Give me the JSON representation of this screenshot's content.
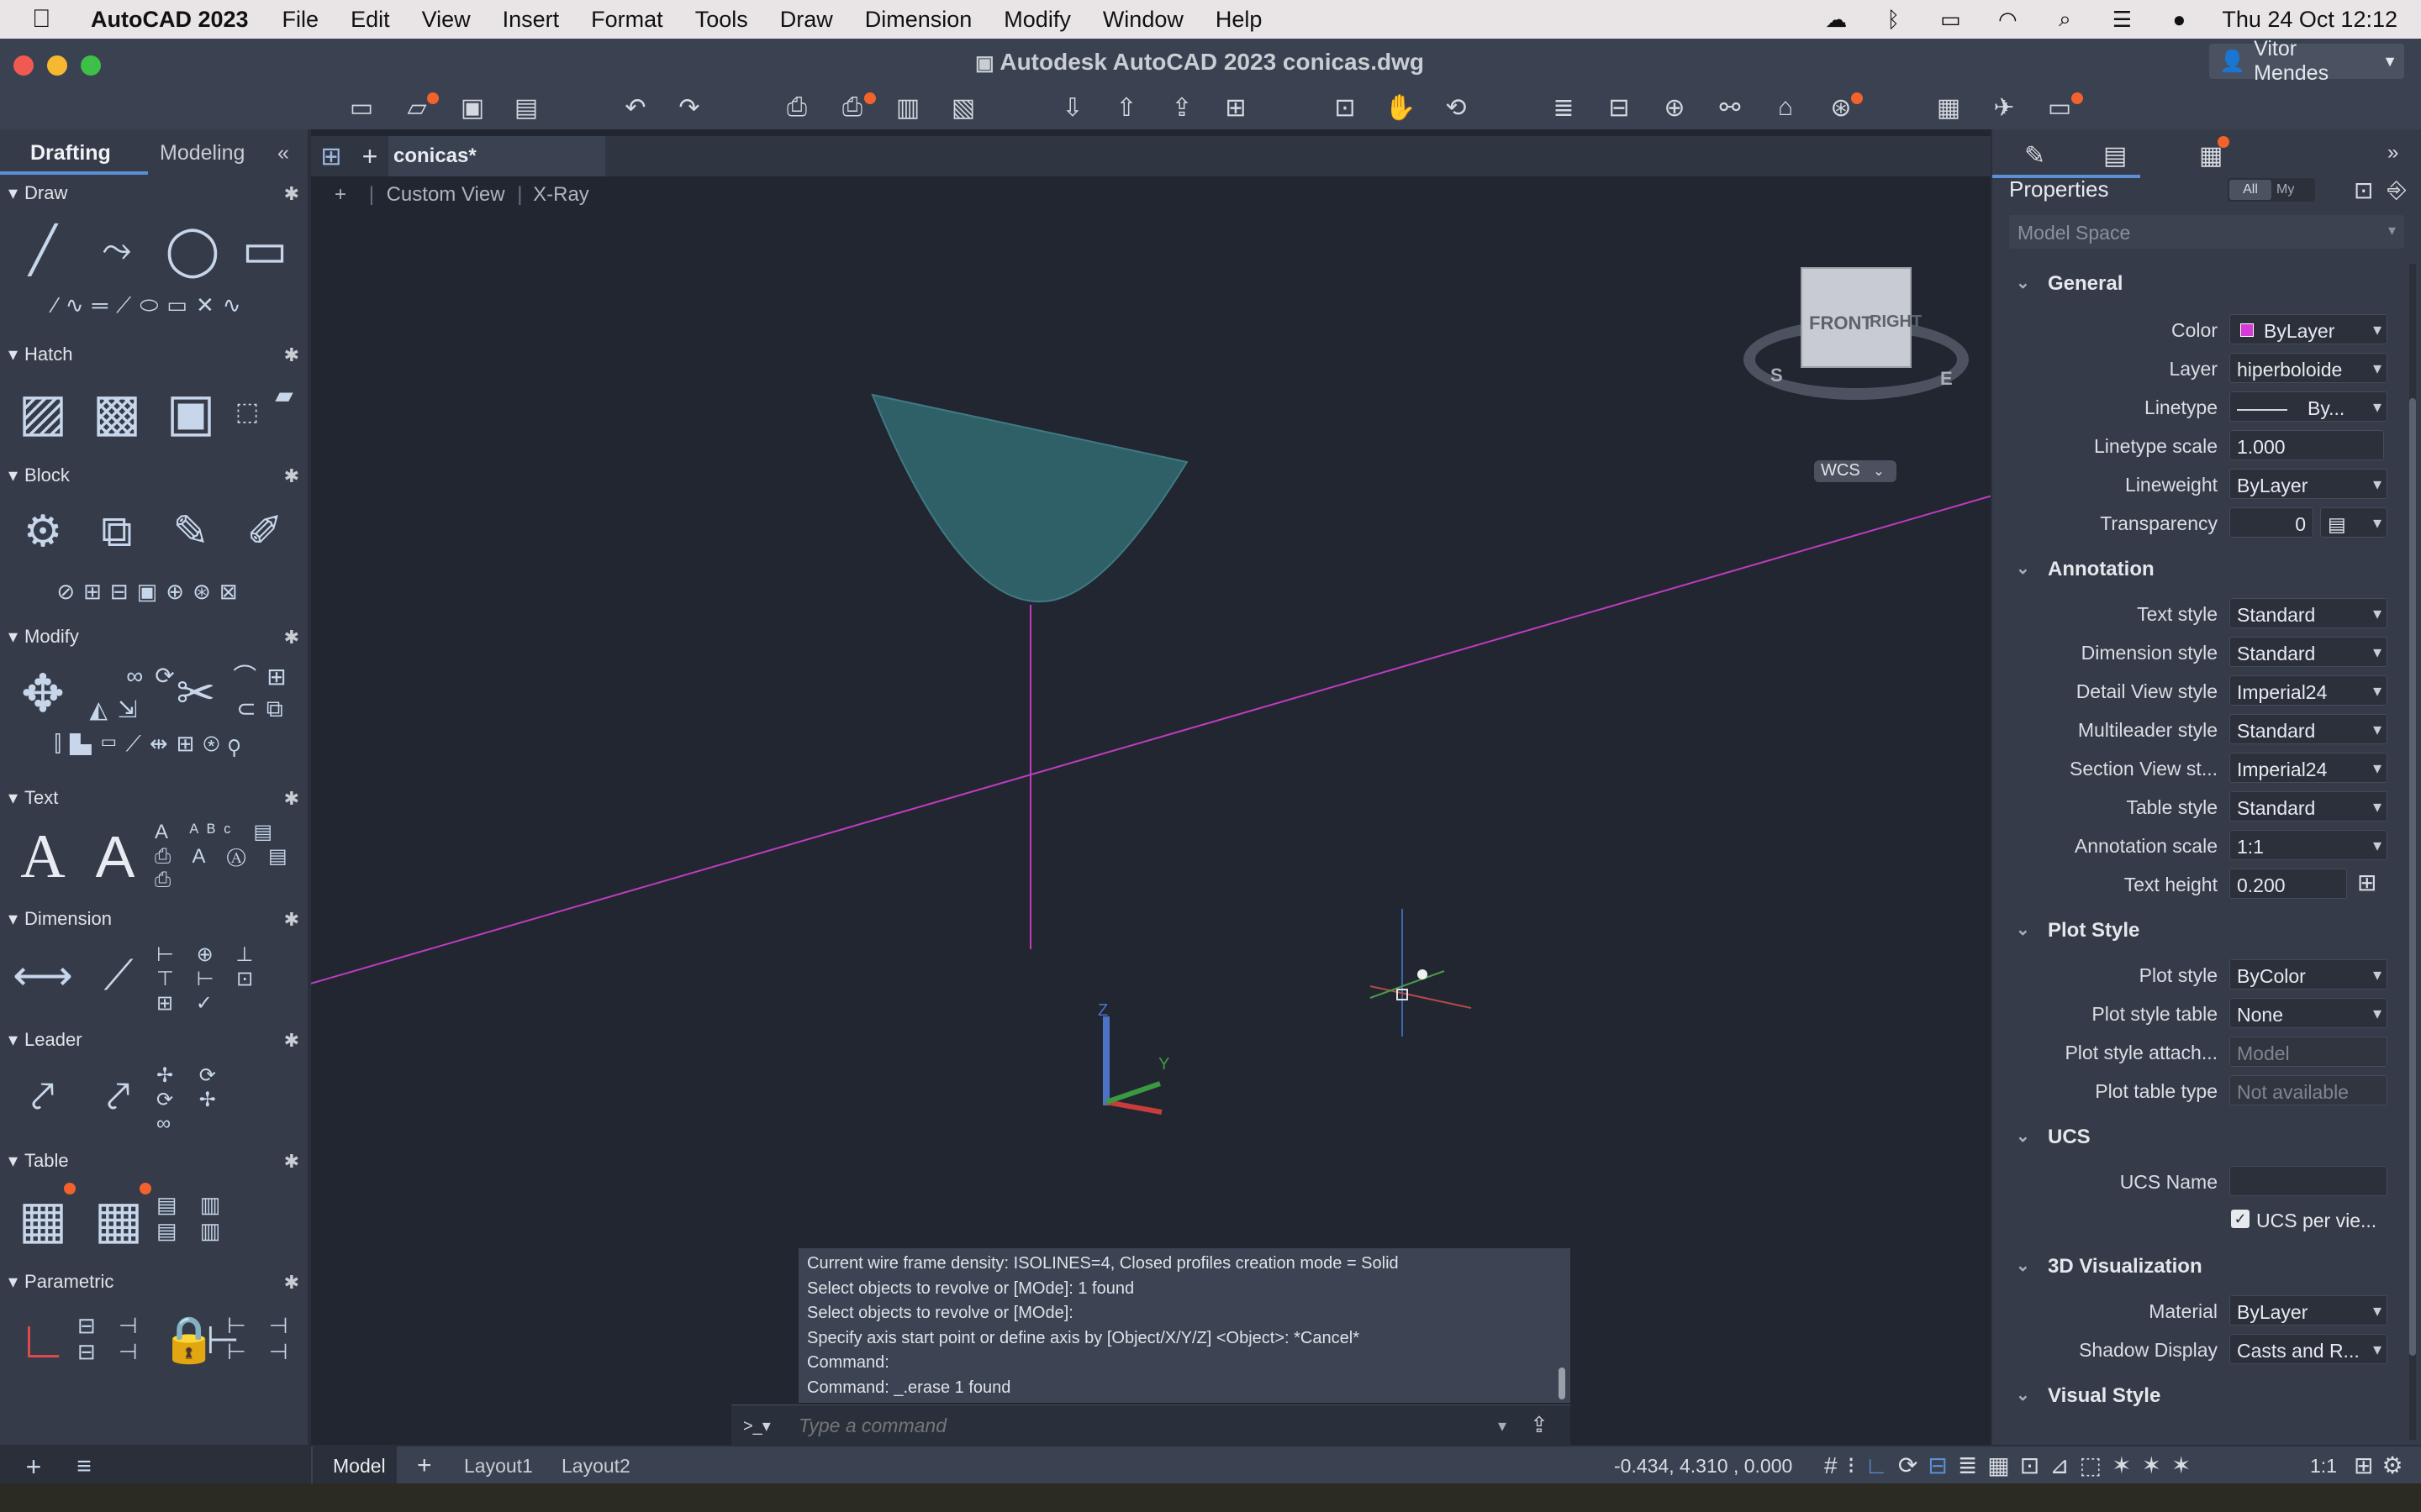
{
  "menubar": {
    "app_name": "AutoCAD 2023",
    "items": [
      "File",
      "Edit",
      "View",
      "Insert",
      "Format",
      "Tools",
      "Draw",
      "Dimension",
      "Modify",
      "Window",
      "Help"
    ],
    "clock": "Thu 24 Oct  12:12"
  },
  "titlebar": {
    "title": "Autodesk AutoCAD 2023    conicas.dwg",
    "user": "Vitor Mendes"
  },
  "left_panel": {
    "tabs": [
      "Drafting",
      "Modeling"
    ],
    "sections": [
      "Draw",
      "Hatch",
      "Block",
      "Modify",
      "Text",
      "Dimension",
      "Leader",
      "Table",
      "Parametric"
    ]
  },
  "doc_tab": "conicas*",
  "viewport": {
    "custom_view": "Custom View",
    "visual_style": "X-Ray",
    "viewcube_front": "FRONT",
    "viewcube_right": "RIGHT",
    "wcs": "WCS",
    "compass_s": "S",
    "compass_e": "E",
    "axis_z": "Z",
    "axis_y": "Y"
  },
  "command": {
    "history": [
      "Current wire frame density:  ISOLINES=4, Closed profiles creation mode = Solid",
      "Select objects to revolve or [MOde]: 1 found",
      "Select objects to revolve or [MOde]:",
      "Specify axis start point or define axis by [Object/X/Y/Z] <Object>: *Cancel*",
      "Command:",
      "Command: _.erase 1 found"
    ],
    "prompt_icon": ">_▾",
    "placeholder": "Type a command"
  },
  "properties": {
    "title": "Properties",
    "filter_all": "All",
    "filter_my": "My",
    "space": "Model Space",
    "general": {
      "title": "General",
      "color_label": "Color",
      "color_value": "ByLayer",
      "color_swatch": "#d63bd6",
      "layer_label": "Layer",
      "layer_value": "hiperboloide",
      "linetype_label": "Linetype",
      "linetype_value": "By...",
      "linetype_scale_label": "Linetype scale",
      "linetype_scale_value": "1.000",
      "lineweight_label": "Lineweight",
      "lineweight_value": "ByLayer",
      "transparency_label": "Transparency",
      "transparency_value": "0"
    },
    "annotation": {
      "title": "Annotation",
      "text_style_label": "Text style",
      "text_style_value": "Standard",
      "dim_style_label": "Dimension style",
      "dim_style_value": "Standard",
      "detail_view_label": "Detail View style",
      "detail_view_value": "Imperial24",
      "multileader_label": "Multileader style",
      "multileader_value": "Standard",
      "section_view_label": "Section View st...",
      "section_view_value": "Imperial24",
      "table_style_label": "Table style",
      "table_style_value": "Standard",
      "annotation_scale_label": "Annotation scale",
      "annotation_scale_value": "1:1",
      "text_height_label": "Text height",
      "text_height_value": "0.200"
    },
    "plot_style": {
      "title": "Plot Style",
      "plot_style_label": "Plot style",
      "plot_style_value": "ByColor",
      "plot_style_table_label": "Plot style table",
      "plot_style_table_value": "None",
      "plot_style_attach_label": "Plot style attach...",
      "plot_style_attach_value": "Model",
      "plot_table_type_label": "Plot table type",
      "plot_table_type_value": "Not available"
    },
    "ucs": {
      "title": "UCS",
      "ucs_name_label": "UCS Name",
      "ucs_name_value": "",
      "ucs_per_view": "UCS per vie..."
    },
    "viz3d": {
      "title": "3D Visualization",
      "material_label": "Material",
      "material_value": "ByLayer",
      "shadow_label": "Shadow Display",
      "shadow_value": "Casts and R..."
    },
    "visual_style": {
      "title": "Visual Style"
    }
  },
  "status": {
    "layout_tabs": [
      "Model",
      "Layout1",
      "Layout2"
    ],
    "coords": "-0.434, 4.310 , 0.000",
    "scale": "1:1"
  },
  "colors": {
    "canvas": "#212630",
    "shape_fill": "#2f6068",
    "axis_line": "#c03cc0",
    "accent_orange": "#f2622c"
  }
}
